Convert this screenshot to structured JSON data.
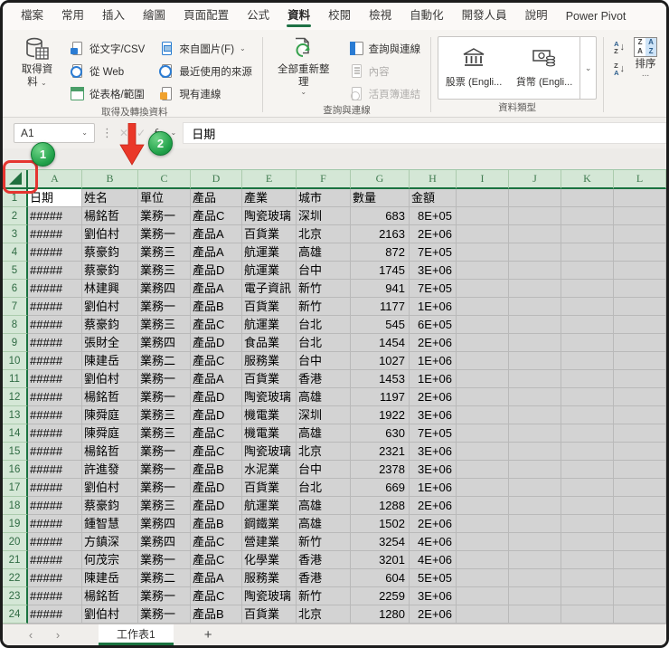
{
  "menu": {
    "tabs": [
      "檔案",
      "常用",
      "插入",
      "繪圖",
      "頁面配置",
      "公式",
      "資料",
      "校閱",
      "檢視",
      "自動化",
      "開發人員",
      "說明",
      "Power Pivot"
    ],
    "active": "資料"
  },
  "ribbon": {
    "groups": [
      {
        "label": "取得及轉換資料",
        "big": {
          "label": "取得資料",
          "icon": "database"
        },
        "items": [
          {
            "label": "從文字/CSV",
            "icon": "doc-csv"
          },
          {
            "label": "從 Web",
            "icon": "doc-web"
          },
          {
            "label": "從表格/範圍",
            "icon": "table-range"
          },
          {
            "label": "來自圖片(F)",
            "icon": "picture",
            "dropdown": true
          },
          {
            "label": "最近使用的來源",
            "icon": "recent"
          },
          {
            "label": "現有連線",
            "icon": "connections"
          }
        ]
      },
      {
        "label": "查詢與連線",
        "big": {
          "label": "全部重新整理",
          "icon": "refresh"
        },
        "items": [
          {
            "label": "查詢與連線",
            "icon": "queries-pane"
          },
          {
            "label": "內容",
            "icon": "properties",
            "disabled": true
          },
          {
            "label": "活頁簿連結",
            "icon": "workbook-links",
            "disabled": true
          }
        ]
      },
      {
        "label": "資料類型",
        "gallery": [
          {
            "label": "股票 (Engli...",
            "icon": "bank"
          },
          {
            "label": "貨幣 (Engli...",
            "icon": "currency"
          }
        ]
      },
      {
        "label": "",
        "sort": {
          "letter_a": "A",
          "letter_z": "Z",
          "big": "排序",
          "more": "..."
        }
      }
    ]
  },
  "icons": {
    "chevron": "⌄",
    "dots": "⋮",
    "cancel": "✕",
    "enter": "✓",
    "fx": "fx",
    "nav_left": "‹",
    "nav_right": "›",
    "add": "+",
    "sort_arrow": "↓",
    "gallery_scroll": "⌄"
  },
  "formula_bar": {
    "name_box": "A1",
    "value": "日期"
  },
  "annotations": {
    "badge_1": "1",
    "badge_2": "2"
  },
  "grid": {
    "column_letters": [
      "A",
      "B",
      "C",
      "D",
      "E",
      "F",
      "G",
      "H",
      "I",
      "J",
      "K",
      "L"
    ],
    "active_cell": "A1",
    "header_row": [
      "日期",
      "姓名",
      "單位",
      "產品",
      "產業",
      "城市",
      "數量",
      "金額"
    ],
    "rows": [
      [
        "#####",
        "楊銘哲",
        "業務一",
        "產品C",
        "陶瓷玻璃",
        "深圳",
        "683",
        "8E+05"
      ],
      [
        "#####",
        "劉伯村",
        "業務一",
        "產品A",
        "百貨業",
        "北京",
        "2163",
        "2E+06"
      ],
      [
        "#####",
        "蔡豪鈞",
        "業務三",
        "產品A",
        "航運業",
        "高雄",
        "872",
        "7E+05"
      ],
      [
        "#####",
        "蔡豪鈞",
        "業務三",
        "產品D",
        "航運業",
        "台中",
        "1745",
        "3E+06"
      ],
      [
        "#####",
        "林建興",
        "業務四",
        "產品A",
        "電子資訊",
        "新竹",
        "941",
        "7E+05"
      ],
      [
        "#####",
        "劉伯村",
        "業務一",
        "產品B",
        "百貨業",
        "新竹",
        "1177",
        "1E+06"
      ],
      [
        "#####",
        "蔡豪鈞",
        "業務三",
        "產品C",
        "航運業",
        "台北",
        "545",
        "6E+05"
      ],
      [
        "#####",
        "張財全",
        "業務四",
        "產品D",
        "食品業",
        "台北",
        "1454",
        "2E+06"
      ],
      [
        "#####",
        "陳建岳",
        "業務二",
        "產品C",
        "服務業",
        "台中",
        "1027",
        "1E+06"
      ],
      [
        "#####",
        "劉伯村",
        "業務一",
        "產品A",
        "百貨業",
        "香港",
        "1453",
        "1E+06"
      ],
      [
        "#####",
        "楊銘哲",
        "業務一",
        "產品D",
        "陶瓷玻璃",
        "高雄",
        "1197",
        "2E+06"
      ],
      [
        "#####",
        "陳舜庭",
        "業務三",
        "產品D",
        "機電業",
        "深圳",
        "1922",
        "3E+06"
      ],
      [
        "#####",
        "陳舜庭",
        "業務三",
        "產品C",
        "機電業",
        "高雄",
        "630",
        "7E+05"
      ],
      [
        "#####",
        "楊銘哲",
        "業務一",
        "產品C",
        "陶瓷玻璃",
        "北京",
        "2321",
        "3E+06"
      ],
      [
        "#####",
        "許進發",
        "業務一",
        "產品B",
        "水泥業",
        "台中",
        "2378",
        "3E+06"
      ],
      [
        "#####",
        "劉伯村",
        "業務一",
        "產品D",
        "百貨業",
        "台北",
        "669",
        "1E+06"
      ],
      [
        "#####",
        "蔡豪鈞",
        "業務三",
        "產品D",
        "航運業",
        "高雄",
        "1288",
        "2E+06"
      ],
      [
        "#####",
        "鍾智慧",
        "業務四",
        "產品B",
        "鋼鐵業",
        "高雄",
        "1502",
        "2E+06"
      ],
      [
        "#####",
        "方鎮深",
        "業務四",
        "產品C",
        "營建業",
        "新竹",
        "3254",
        "4E+06"
      ],
      [
        "#####",
        "何茂宗",
        "業務一",
        "產品C",
        "化學業",
        "香港",
        "3201",
        "4E+06"
      ],
      [
        "#####",
        "陳建岳",
        "業務二",
        "產品A",
        "服務業",
        "香港",
        "604",
        "5E+05"
      ],
      [
        "#####",
        "楊銘哲",
        "業務一",
        "產品C",
        "陶瓷玻璃",
        "新竹",
        "2259",
        "3E+06"
      ],
      [
        "#####",
        "劉伯村",
        "業務一",
        "產品B",
        "百貨業",
        "北京",
        "1280",
        "2E+06"
      ]
    ]
  },
  "sheet_bar": {
    "active_tab": "工作表1"
  },
  "colors": {
    "excel_green": "#1a7340",
    "selection_gray": "#d3d3d3",
    "header_green": "#d4e7d6",
    "annotation_red": "#e53530",
    "badge_green": "#22a24b"
  }
}
